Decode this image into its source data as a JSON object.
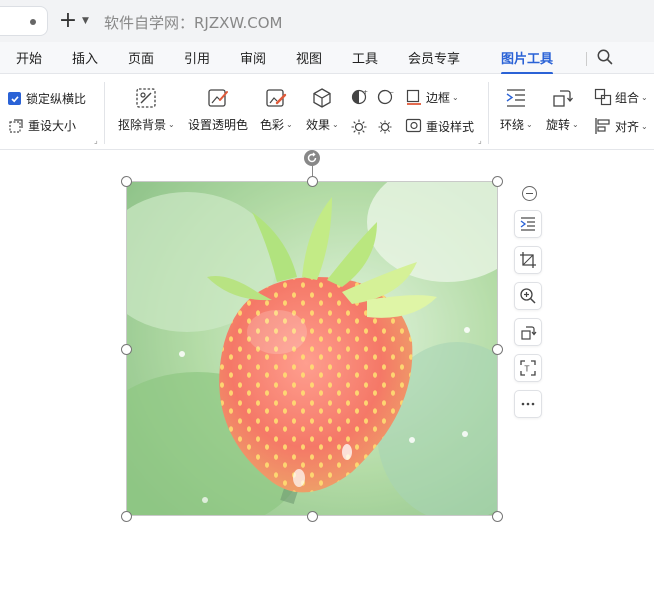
{
  "tabstrip": {
    "site_title": "软件自学网：RJZXW.COM"
  },
  "menu": {
    "items": [
      "开始",
      "插入",
      "页面",
      "引用",
      "审阅",
      "视图",
      "工具",
      "会员专享",
      "图片工具"
    ],
    "active": "图片工具"
  },
  "ribbon": {
    "lock_ratio": "锁定纵横比",
    "lock_ratio_checked": true,
    "resize": "重设大小",
    "remove_bg": "抠除背景",
    "set_transparent": "设置透明色",
    "color": "色彩",
    "effects": "效果",
    "border": "边框",
    "reset_style": "重设样式",
    "wrap": "环绕",
    "rotate": "旋转",
    "group": "组合",
    "align": "对齐"
  },
  "colors": {
    "accent": "#2a62d6",
    "menubar_bg": "#f7f8fa",
    "tabstrip_bg": "#f2f3f5"
  },
  "side_tools": [
    "minus-icon",
    "layout-wrap-icon",
    "crop-icon",
    "zoom-in-icon",
    "rotate-icon",
    "ocr-scan-icon",
    "more-icon"
  ]
}
